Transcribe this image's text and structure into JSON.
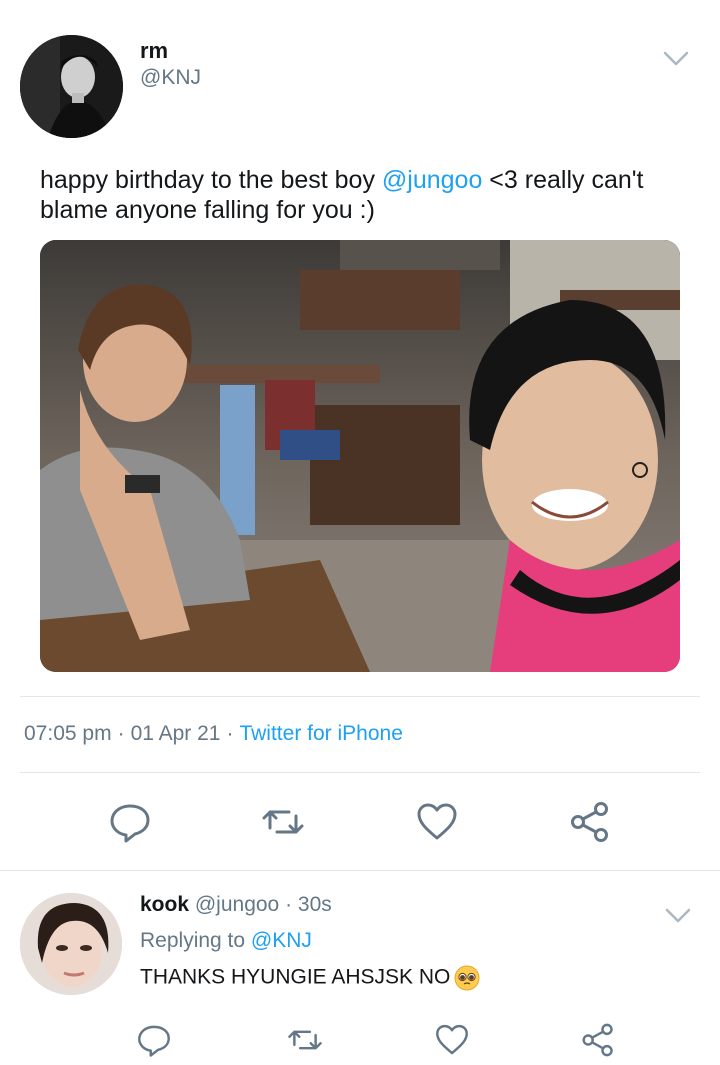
{
  "tweet": {
    "name": "rm",
    "handle": "@KNJ",
    "text_before": "happy birthday to the best boy ",
    "mention": "@jungoo",
    "text_after": " <3 really can't blame anyone falling for you :)",
    "time": "07:05 pm",
    "date": "01 Apr 21",
    "source": "Twitter for iPhone",
    "actions": [
      "reply-icon",
      "retweet-icon",
      "like-icon",
      "share-icon"
    ]
  },
  "reply": {
    "name": "kook",
    "handle": "@jungoo",
    "age": "30s",
    "replying_label": "Replying to",
    "replying_to": "@KNJ",
    "text": "THANKS HYUNGIE AHSJSK NO",
    "emoji": "pleading-face-emoji"
  },
  "colors": {
    "accent": "#1da1f2",
    "secondary_text": "#657786",
    "divider": "#e1e8ed"
  }
}
